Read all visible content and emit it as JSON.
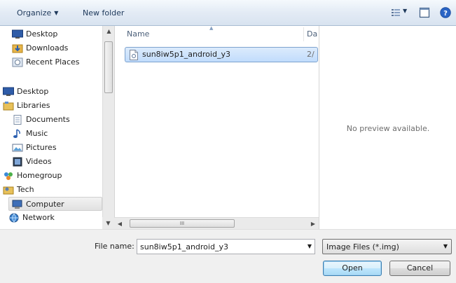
{
  "toolbar": {
    "organize_label": "Organize",
    "new_folder_label": "New folder"
  },
  "nav": {
    "items": [
      {
        "label": "Desktop",
        "icon": "desktop-icon"
      },
      {
        "label": "Downloads",
        "icon": "downloads-icon"
      },
      {
        "label": "Recent Places",
        "icon": "recent-places-icon"
      },
      {
        "label": "Desktop",
        "icon": "desktop-icon"
      },
      {
        "label": "Libraries",
        "icon": "libraries-icon"
      },
      {
        "label": "Documents",
        "icon": "documents-icon"
      },
      {
        "label": "Music",
        "icon": "music-icon"
      },
      {
        "label": "Pictures",
        "icon": "pictures-icon"
      },
      {
        "label": "Videos",
        "icon": "videos-icon"
      },
      {
        "label": "Homegroup",
        "icon": "homegroup-icon"
      },
      {
        "label": "Tech",
        "icon": "user-folder-icon"
      },
      {
        "label": "Computer",
        "icon": "computer-icon"
      },
      {
        "label": "Network",
        "icon": "network-icon"
      }
    ],
    "selected_index": 11
  },
  "filelist": {
    "columns": {
      "name": "Name",
      "date": "Da"
    },
    "rows": [
      {
        "name": "sun8iw5p1_android_y3",
        "date": "2/",
        "icon": "file-icon"
      }
    ]
  },
  "preview": {
    "message": "No preview available."
  },
  "bottom": {
    "file_name_label": "File name:",
    "file_name_value": "sun8iw5p1_android_y3",
    "filter_value": "Image Files (*.img)",
    "open_label": "Open",
    "cancel_label": "Cancel"
  },
  "colors": {
    "toolbar_text": "#1e395b",
    "selection_bg": "#c1dcfc",
    "selection_border": "#7da2ce"
  }
}
